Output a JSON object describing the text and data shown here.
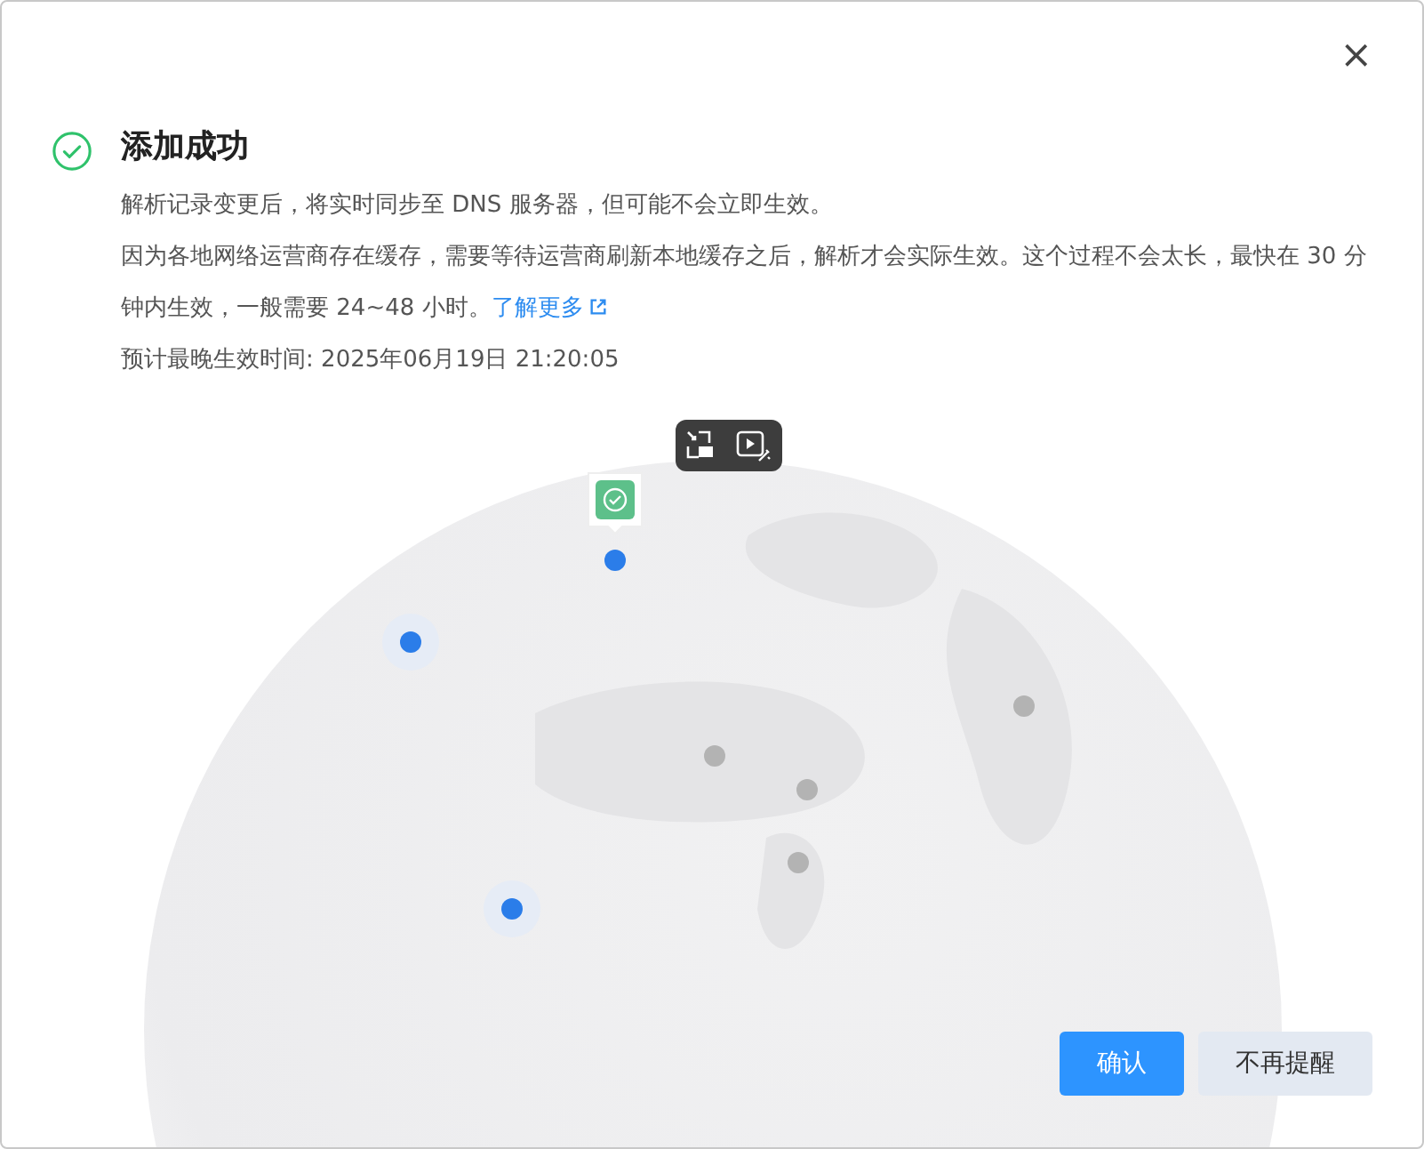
{
  "dialog": {
    "close": "×",
    "title": "添加成功",
    "messages": [
      {
        "text": "解析记录变更后，将实时同步至 DNS 服务器，但可能不会立即生效。"
      },
      {
        "text": "因为各地网络运营商存在缓存，需要等待运营商刷新本地缓存之后，解析才会实际生效。这个过程不会太长，最快在 30 分钟内生效，一般需要 24~48 小时。",
        "link": "了解更多"
      },
      {
        "text": "预计最晚生效时间: 2025年06月19日 21:20:05"
      }
    ]
  },
  "map": {
    "markers": [
      {
        "color": "#2b7de9",
        "halo": false,
        "verified": true
      },
      {
        "color": "#2b7de9",
        "halo": true,
        "verified": false
      },
      {
        "color": "#2b7de9",
        "halo": true,
        "verified": false
      },
      {
        "color": "#b3b3b3",
        "halo": false,
        "verified": false
      },
      {
        "color": "#b3b3b3",
        "halo": false,
        "verified": false
      },
      {
        "color": "#b3b3b3",
        "halo": false,
        "verified": false
      },
      {
        "color": "#b3b3b3",
        "halo": false,
        "verified": false
      }
    ]
  },
  "buttons": [
    {
      "label": "确认",
      "kind": "primary"
    },
    {
      "label": "不再提醒",
      "kind": "secondary"
    }
  ]
}
